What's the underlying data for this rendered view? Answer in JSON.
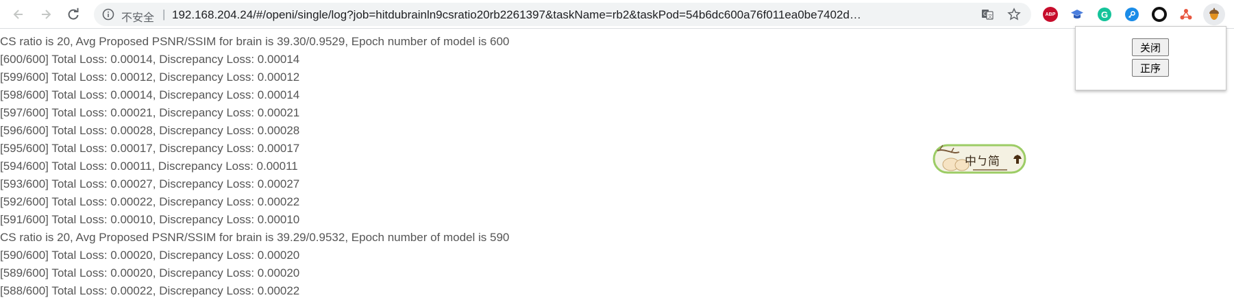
{
  "browser": {
    "security_label": "不安全",
    "url": "192.168.204.24/#/openi/single/log?job=hitdubrainln9csratio20rb2261397&taskName=rb2&taskPod=54b6dc600a76f011ea0be7402db12...",
    "icons": [
      "back-arrow-icon",
      "forward-arrow-icon",
      "reload-icon",
      "info-icon",
      "translate-icon",
      "bookmark-star-icon",
      "adblock-plus-icon",
      "graduation-cap-icon",
      "grammarly-icon",
      "key-icon",
      "ring-icon",
      "molecule-icon",
      "acorn-profile-icon"
    ],
    "colors": {
      "abp": "#c70d2c",
      "grammarly": "#15c39a",
      "key": "#1a8ce8",
      "molecule": "#e8563f",
      "acorn": "#e39221"
    }
  },
  "extensions": {
    "abp_label": "ABP",
    "grammarly_label": "G"
  },
  "log": {
    "lines": [
      "CS ratio is 20, Avg Proposed PSNR/SSIM for brain is 39.30/0.9529, Epoch number of model is 600",
      "[600/600] Total Loss: 0.00014, Discrepancy Loss: 0.00014",
      "[599/600] Total Loss: 0.00012, Discrepancy Loss: 0.00012",
      "[598/600] Total Loss: 0.00014, Discrepancy Loss: 0.00014",
      "[597/600] Total Loss: 0.00021, Discrepancy Loss: 0.00021",
      "[596/600] Total Loss: 0.00028, Discrepancy Loss: 0.00028",
      "[595/600] Total Loss: 0.00017, Discrepancy Loss: 0.00017",
      "[594/600] Total Loss: 0.00011, Discrepancy Loss: 0.00011",
      "[593/600] Total Loss: 0.00027, Discrepancy Loss: 0.00027",
      "[592/600] Total Loss: 0.00022, Discrepancy Loss: 0.00022",
      "[591/600] Total Loss: 0.00010, Discrepancy Loss: 0.00010",
      "CS ratio is 20, Avg Proposed PSNR/SSIM for brain is 39.29/0.9532, Epoch number of model is 590",
      "[590/600] Total Loss: 0.00020, Discrepancy Loss: 0.00020",
      "[589/600] Total Loss: 0.00020, Discrepancy Loss: 0.00020",
      "[588/600] Total Loss: 0.00022, Discrepancy Loss: 0.00022"
    ]
  },
  "panel": {
    "close_label": "关闭",
    "order_label": "正序"
  },
  "ime": {
    "text": "中ㄅ简",
    "icon": "ime-badge-icon"
  }
}
